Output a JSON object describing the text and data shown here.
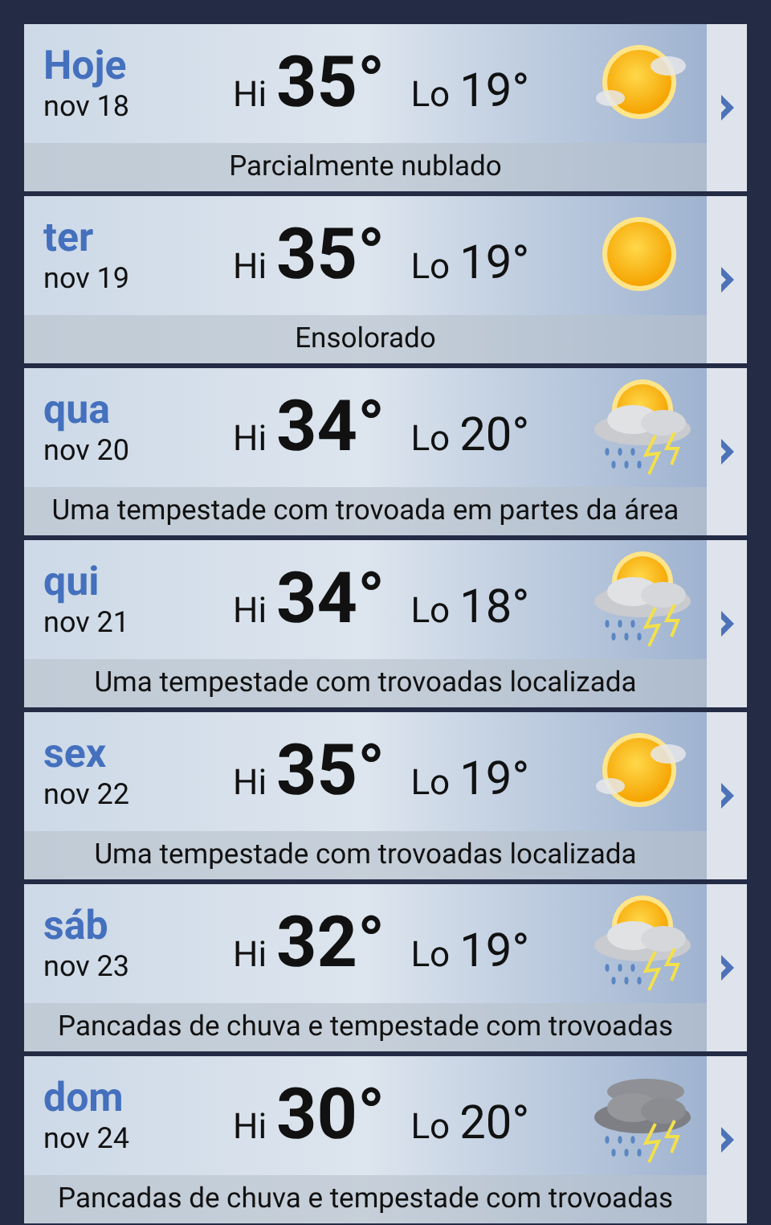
{
  "days": [
    {
      "day": "Hoje",
      "date": "nov 18",
      "hi_label": "Hi",
      "hi": "35°",
      "lo_label": "Lo",
      "lo": "19°",
      "kind": "partly_cloudy",
      "condition": "Parcialmente nublado"
    },
    {
      "day": "ter",
      "date": "nov 19",
      "hi_label": "Hi",
      "hi": "35°",
      "lo_label": "Lo",
      "lo": "19°",
      "kind": "sunny",
      "condition": "Ensolorado"
    },
    {
      "day": "qua",
      "date": "nov 20",
      "hi_label": "Hi",
      "hi": "34°",
      "lo_label": "Lo",
      "lo": "20°",
      "kind": "sun_storm",
      "condition": "Uma tempestade com trovoada em partes da área"
    },
    {
      "day": "qui",
      "date": "nov 21",
      "hi_label": "Hi",
      "hi": "34°",
      "lo_label": "Lo",
      "lo": "18°",
      "kind": "sun_storm",
      "condition": "Uma tempestade com trovoadas localizada"
    },
    {
      "day": "sex",
      "date": "nov 22",
      "hi_label": "Hi",
      "hi": "35°",
      "lo_label": "Lo",
      "lo": "19°",
      "kind": "partly_cloudy",
      "condition": "Uma tempestade com trovoadas localizada"
    },
    {
      "day": "sáb",
      "date": "nov 23",
      "hi_label": "Hi",
      "hi": "32°",
      "lo_label": "Lo",
      "lo": "19°",
      "kind": "sun_storm",
      "condition": "Pancadas de chuva e tempestade com trovoadas"
    },
    {
      "day": "dom",
      "date": "nov 24",
      "hi_label": "Hi",
      "hi": "30°",
      "lo_label": "Lo",
      "lo": "20°",
      "kind": "storm",
      "condition": "Pancadas de chuva e tempestade com trovoadas"
    }
  ]
}
